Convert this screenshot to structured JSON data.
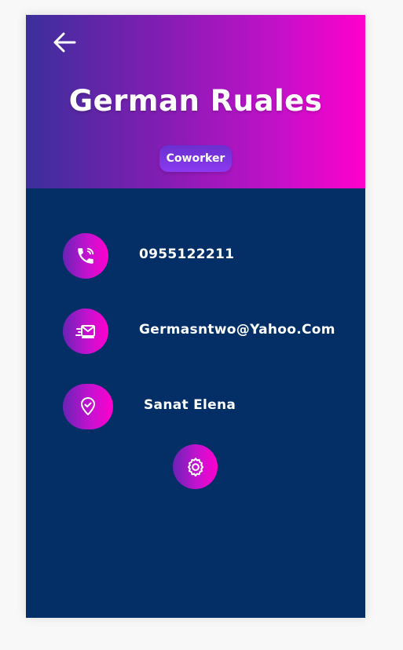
{
  "header": {
    "back_icon": "arrow-left-icon",
    "title": "German Ruales",
    "tag": "Coworker",
    "gradient_colors": [
      "#3b2f9c",
      "#ff00cc"
    ]
  },
  "contact": {
    "phone": {
      "icon": "phone-icon",
      "value": "0955122211"
    },
    "email": {
      "icon": "mail-icon",
      "value": "Germasntwo@Yahoo.Com"
    },
    "location": {
      "icon": "location-check-icon",
      "value": "Sanat Elena"
    }
  },
  "settings": {
    "icon": "gear-icon"
  },
  "colors": {
    "background": "#032f66",
    "accent": "#ff00cc",
    "text": "#ffffff"
  }
}
